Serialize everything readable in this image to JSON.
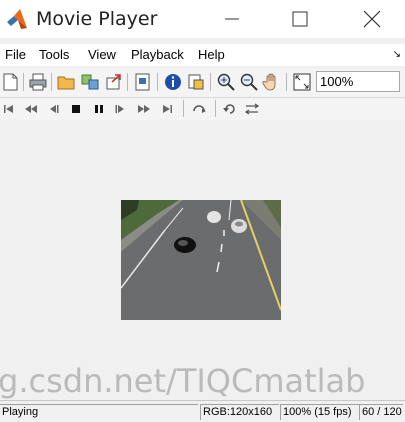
{
  "window": {
    "title": "Movie Player"
  },
  "menu": {
    "file": "File",
    "tools": "Tools",
    "view": "View",
    "playback": "Playback",
    "help": "Help",
    "overflow": "↘"
  },
  "toolbar": {
    "zoom_value": "100%"
  },
  "watermark": "g.csdn.net/TIQCmatlab",
  "status": {
    "state": "Playing",
    "info": "RGB:120x160",
    "rate": "100% (15 fps)",
    "frame": "60 / 120"
  },
  "colors": {
    "accent_logo": "#e86a1a",
    "info_icon": "#1e4fa8",
    "folder": "#f2b84b"
  },
  "icons": [
    "new-icon",
    "print-icon",
    "open-icon",
    "connect-icon",
    "export-icon",
    "snapshot-icon",
    "info-icon",
    "color-map-icon",
    "zoom-in-icon",
    "zoom-out-icon",
    "pan-icon",
    "fit-window-icon",
    "jump-to-start-icon",
    "rewind-icon",
    "step-back-icon",
    "stop-icon",
    "pause-icon",
    "step-forward-icon",
    "fast-forward-icon",
    "jump-to-end-icon",
    "loop-icon",
    "autoreverse-icon",
    "swap-icon"
  ]
}
